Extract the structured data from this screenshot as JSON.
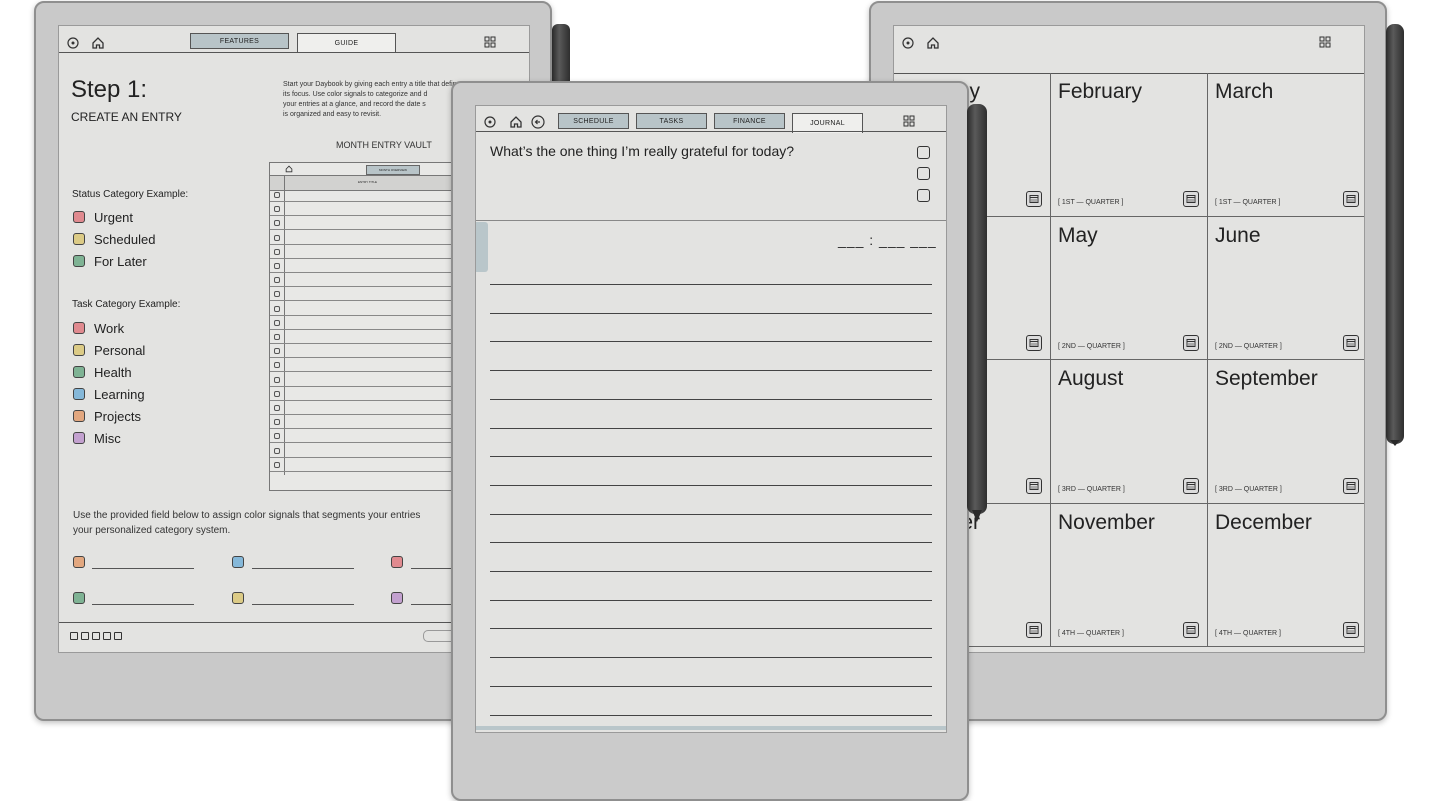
{
  "left_device": {
    "tabs": [
      "FEATURES",
      "GUIDE"
    ],
    "step_title": "Step 1:",
    "step_subtitle": "CREATE AN ENTRY",
    "intro_lines": [
      "Start your Daybook by giving each entry a title that defines",
      "its focus. Use color signals to categorize and d",
      "your entries at a glance, and record the date s",
      "is organized and easy to revisit."
    ],
    "vault_title": "MONTH ENTRY VAULT",
    "vault_tab": "MONTH OVERVIEW",
    "vault_header": "ENTRY TITLE",
    "status_heading": "Status Category Example:",
    "status_items": [
      {
        "label": "Urgent",
        "color": "#e08a8f"
      },
      {
        "label": "Scheduled",
        "color": "#dccb86"
      },
      {
        "label": "For Later",
        "color": "#7fb394"
      }
    ],
    "task_heading": "Task Category Example:",
    "task_items": [
      {
        "label": "Work",
        "color": "#e08a8f"
      },
      {
        "label": "Personal",
        "color": "#dccb86"
      },
      {
        "label": "Health",
        "color": "#7fb394"
      },
      {
        "label": "Learning",
        "color": "#85b8d9"
      },
      {
        "label": "Projects",
        "color": "#e2a77f"
      },
      {
        "label": "Misc",
        "color": "#c3a1cf"
      }
    ],
    "assign_lines": [
      "Use the provided field below to assign color signals that segments your entries",
      "your personalized category system."
    ],
    "assign_swatches": [
      "#e2a77f",
      "#85b8d9",
      "#e08a8f",
      "#7fb394",
      "#dccb86",
      "#c3a1cf"
    ]
  },
  "center_device": {
    "tabs": [
      "SCHEDULE",
      "TASKS",
      "FINANCE",
      "JOURNAL"
    ],
    "active_tab": "JOURNAL",
    "prompt": "What’s the one thing I’m really grateful for today?",
    "time_field": "___ : ___ ___"
  },
  "right_device": {
    "months": [
      {
        "name": "y",
        "quarter": ""
      },
      {
        "name": "February",
        "quarter": "[ 1ST — QUARTER ]"
      },
      {
        "name": "March",
        "quarter": "[ 1ST — QUARTER ]"
      },
      {
        "name": "",
        "quarter": ""
      },
      {
        "name": "May",
        "quarter": "[ 2ND — QUARTER ]"
      },
      {
        "name": "June",
        "quarter": "[ 2ND — QUARTER ]"
      },
      {
        "name": "",
        "quarter": ""
      },
      {
        "name": "August",
        "quarter": "[ 3RD — QUARTER ]"
      },
      {
        "name": "September",
        "quarter": "[ 3RD — QUARTER ]"
      },
      {
        "name": "er",
        "quarter": "]"
      },
      {
        "name": "November",
        "quarter": "[ 4TH — QUARTER ]"
      },
      {
        "name": "December",
        "quarter": "[ 4TH — QUARTER ]"
      }
    ]
  },
  "colors": {
    "device": "#c9c9c9",
    "screen": "#e3e3e1",
    "active_tab": "#b8c4c8"
  }
}
